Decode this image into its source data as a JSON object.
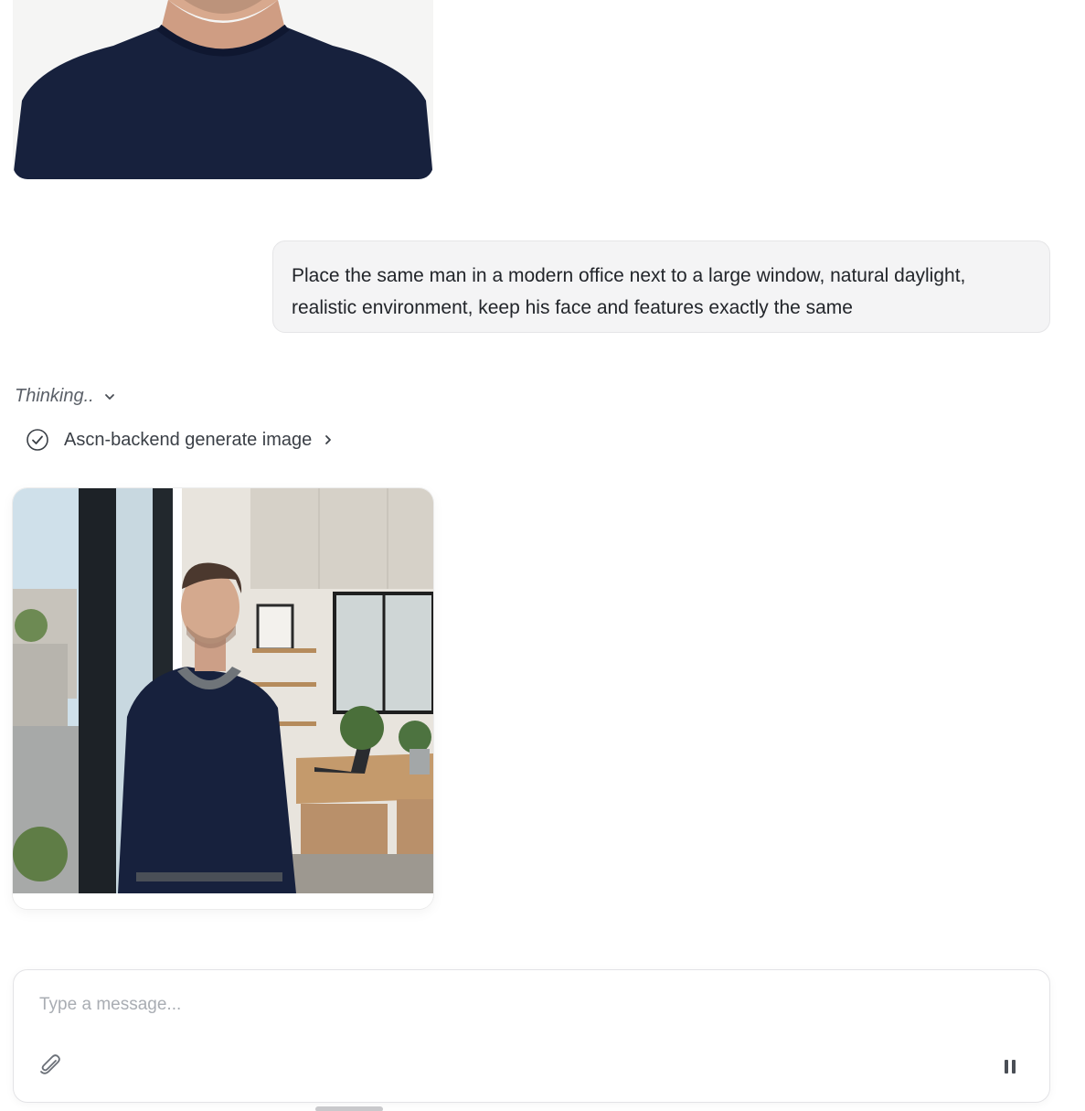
{
  "previous_image": {
    "alt": "Portrait of a man in a navy t-shirt"
  },
  "user_message": {
    "text": "Place the same man in a modern office next to a large window, natural daylight, realistic environment, keep his face and features exactly the same"
  },
  "thinking": {
    "label": "Thinking..",
    "icon": "chevron-down-icon"
  },
  "tool_call": {
    "label": "Ascn-backend generate image",
    "status_icon": "check-circle-icon",
    "expand_icon": "chevron-right-icon"
  },
  "generated_image": {
    "alt": "Man in navy sweater standing next to a large window in a modern office"
  },
  "composer": {
    "placeholder": "Type a message...",
    "value": "",
    "attach_icon": "paperclip-icon",
    "action_icon": "pause-icon"
  },
  "colors": {
    "bubble_bg": "#f4f4f5",
    "navy_shirt": "#17213d",
    "text": "#1f2329",
    "muted": "#5b6068"
  }
}
